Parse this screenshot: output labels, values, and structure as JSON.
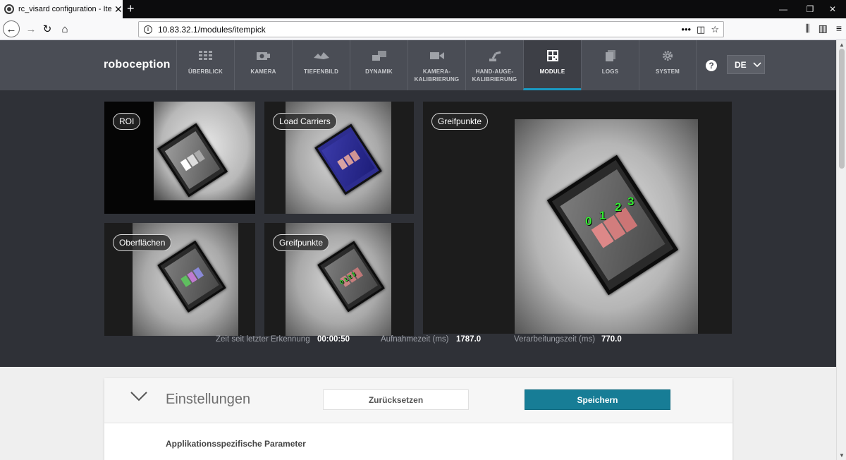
{
  "browser": {
    "tab_title": "rc_visard configuration - Item P",
    "url": "10.83.32.1/modules/itempick",
    "new_tab": "+",
    "window_controls": [
      "—",
      "❐",
      "✕"
    ]
  },
  "header": {
    "logo": "roboception",
    "menu": [
      {
        "label": "ÜBERBLICK",
        "icon": "grid-icon"
      },
      {
        "label": "KAMERA",
        "icon": "camera-icon"
      },
      {
        "label": "TIEFENBILD",
        "icon": "depth-icon"
      },
      {
        "label": "DYNAMIK",
        "icon": "dynamics-icon"
      },
      {
        "label": "KAMERA-\nKALIBRIERUNG",
        "icon": "video-camera-icon"
      },
      {
        "label": "HAND-AUGE-\nKALIBRIERUNG",
        "icon": "robot-arm-icon"
      },
      {
        "label": "MODULE",
        "icon": "qr-module-icon",
        "active": true
      },
      {
        "label": "LOGS",
        "icon": "logs-icon"
      },
      {
        "label": "SYSTEM",
        "icon": "gear-icon"
      }
    ],
    "help": "?",
    "language": "DE"
  },
  "views": {
    "roi": "ROI",
    "load_carriers": "Load Carriers",
    "surfaces": "Oberflächen",
    "grasp_points_small": "Greifpunkte",
    "grasp_points_large": "Greifpunkte",
    "grasp_labels": [
      "0",
      "1",
      "2",
      "3"
    ]
  },
  "stats": {
    "last_detection_label": "Zeit seit letzter Erkennung",
    "last_detection_value": "00:00:50",
    "capture_label": "Aufnahmezeit (ms)",
    "capture_value": "1787.0",
    "processing_label": "Verarbeitungszeit (ms)",
    "processing_value": "770.0"
  },
  "settings": {
    "title": "Einstellungen",
    "reset_label": "Zurücksetzen",
    "save_label": "Speichern",
    "section_title": "Applikationsspezifische Parameter"
  },
  "colors": {
    "header_bg": "#4a4d55",
    "viewer_bg": "#2f3137",
    "accent": "#177d96",
    "grasp_point": "#35e834"
  }
}
